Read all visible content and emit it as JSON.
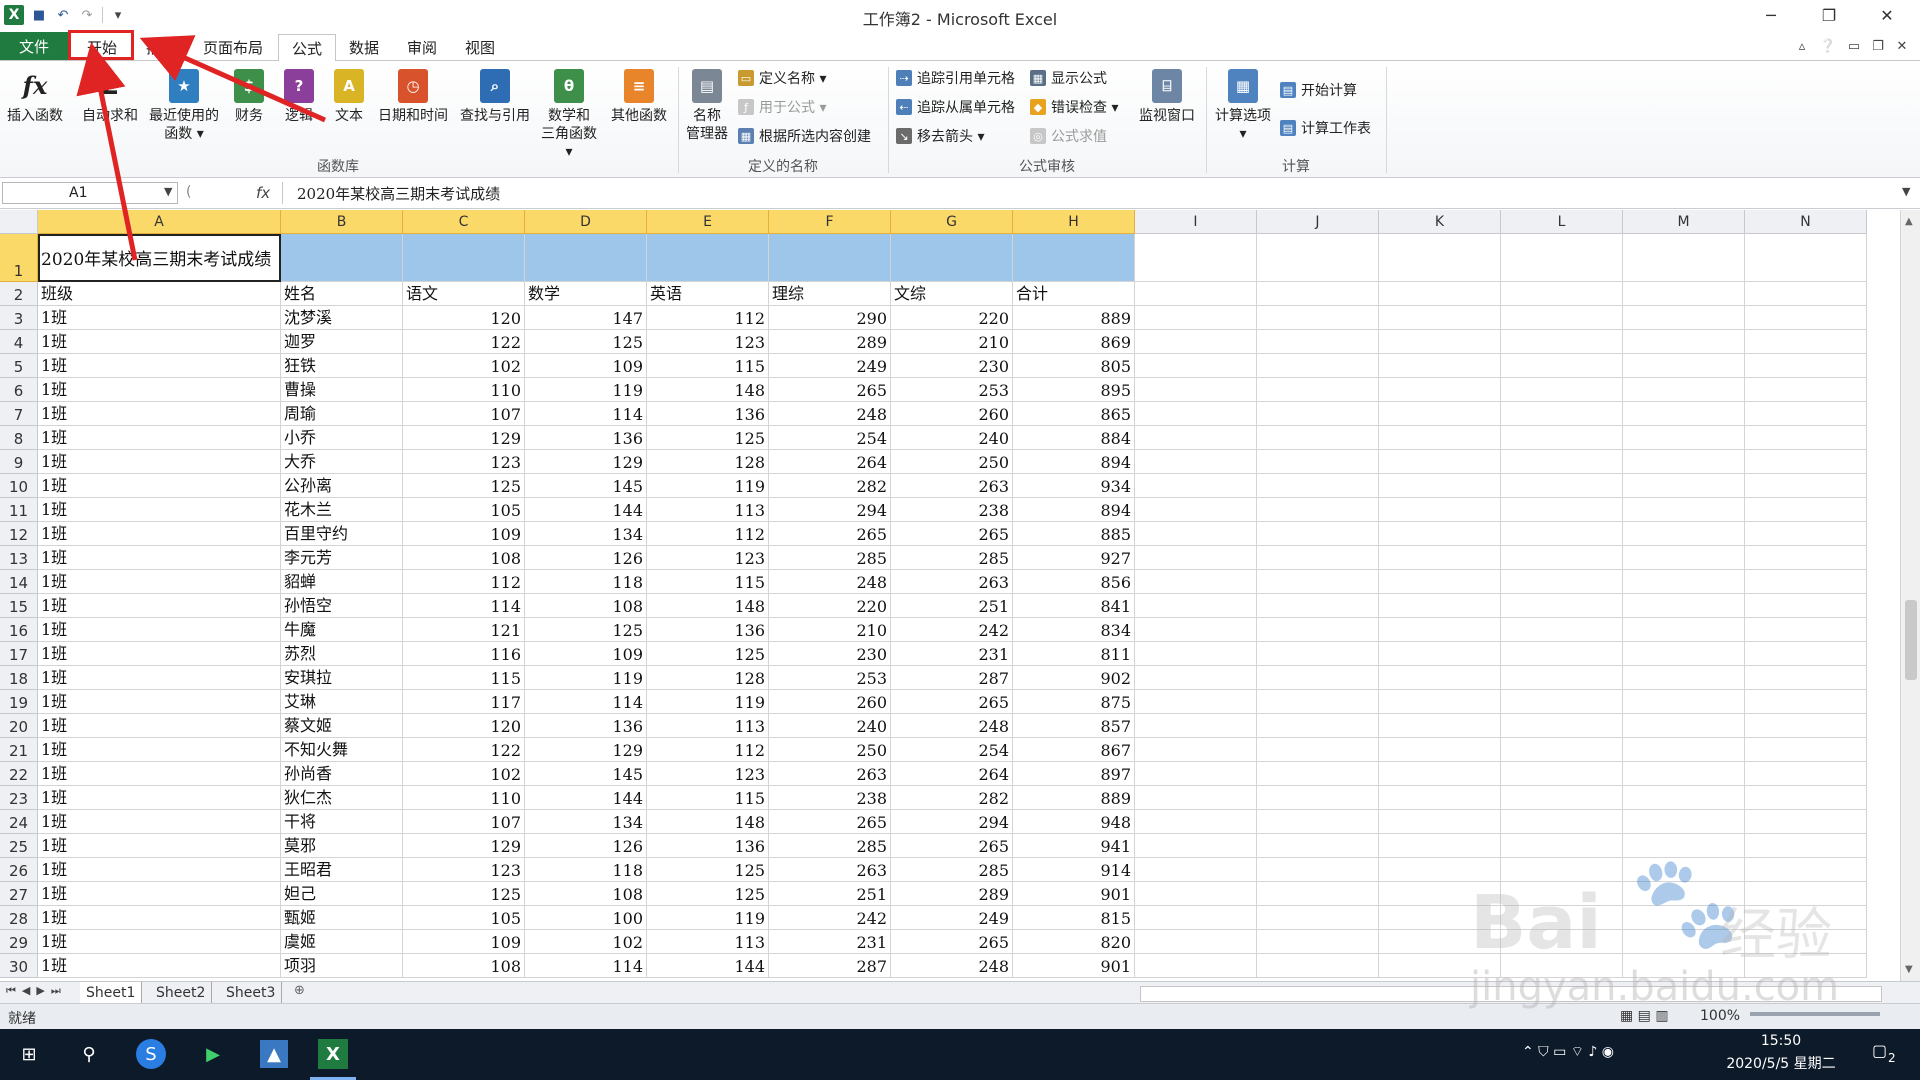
{
  "window": {
    "title": "工作簿2 - Microsoft Excel",
    "minimize": "─",
    "restore": "❐",
    "close": "✕"
  },
  "qat": {
    "logo": "X",
    "save": "💾",
    "undo": "↶",
    "redo": "↷",
    "more": "▾"
  },
  "tabs": [
    {
      "label": "文件"
    },
    {
      "label": "开始"
    },
    {
      "label": "插入"
    },
    {
      "label": "页面布局"
    },
    {
      "label": "公式"
    },
    {
      "label": "数据"
    },
    {
      "label": "审阅"
    },
    {
      "label": "视图"
    }
  ],
  "ribbon": {
    "groups": {
      "function_library": "函数库",
      "defined_names": "定义的名称",
      "formula_auditing": "公式审核",
      "calculation": "计算"
    },
    "insert_function": "插入函数",
    "autosum": "自动求和",
    "recent_1": "最近使用的",
    "recent_2": "函数 ▾",
    "financial": "财务",
    "logical": "逻辑",
    "text": "文本",
    "datetime": "日期和时间",
    "lookup": "查找与引用",
    "math_1": "数学和",
    "math_2": "三角函数 ▾",
    "other": "其他函数",
    "name_mgr_1": "名称",
    "name_mgr_2": "管理器",
    "define_name": "定义名称 ▾",
    "use_in_formula": "用于公式 ▾",
    "create_from_sel": "根据所选内容创建",
    "trace_precedents": "追踪引用单元格",
    "trace_dependents": "追踪从属单元格",
    "remove_arrows": "移去箭头 ▾",
    "show_formulas": "显示公式",
    "error_check": "错误检查 ▾",
    "eval_formula": "公式求值",
    "watch_window": "监视窗口",
    "calc_options": "计算选项",
    "calc_now": "开始计算",
    "calc_sheet": "计算工作表"
  },
  "formula_bar": {
    "name_box": "A1",
    "fx": "fx",
    "formula": "2020年某校高三期末考试成绩"
  },
  "columns": [
    "A",
    "B",
    "C",
    "D",
    "E",
    "F",
    "G",
    "H",
    "I",
    "J",
    "K",
    "L",
    "M",
    "N"
  ],
  "sheet": {
    "title": "2020年某校高三期末考试成绩",
    "headers": [
      "班级",
      "姓名",
      "语文",
      "数学",
      "英语",
      "理综",
      "文综",
      "合计"
    ],
    "rows": [
      [
        "1班",
        "沈梦溪",
        "120",
        "147",
        "112",
        "290",
        "220",
        "889"
      ],
      [
        "1班",
        "迦罗",
        "122",
        "125",
        "123",
        "289",
        "210",
        "869"
      ],
      [
        "1班",
        "狂铁",
        "102",
        "109",
        "115",
        "249",
        "230",
        "805"
      ],
      [
        "1班",
        "曹操",
        "110",
        "119",
        "148",
        "265",
        "253",
        "895"
      ],
      [
        "1班",
        "周瑜",
        "107",
        "114",
        "136",
        "248",
        "260",
        "865"
      ],
      [
        "1班",
        "小乔",
        "129",
        "136",
        "125",
        "254",
        "240",
        "884"
      ],
      [
        "1班",
        "大乔",
        "123",
        "129",
        "128",
        "264",
        "250",
        "894"
      ],
      [
        "1班",
        "公孙离",
        "125",
        "145",
        "119",
        "282",
        "263",
        "934"
      ],
      [
        "1班",
        "花木兰",
        "105",
        "144",
        "113",
        "294",
        "238",
        "894"
      ],
      [
        "1班",
        "百里守约",
        "109",
        "134",
        "112",
        "265",
        "265",
        "885"
      ],
      [
        "1班",
        "李元芳",
        "108",
        "126",
        "123",
        "285",
        "285",
        "927"
      ],
      [
        "1班",
        "貂蝉",
        "112",
        "118",
        "115",
        "248",
        "263",
        "856"
      ],
      [
        "1班",
        "孙悟空",
        "114",
        "108",
        "148",
        "220",
        "251",
        "841"
      ],
      [
        "1班",
        "牛魔",
        "121",
        "125",
        "136",
        "210",
        "242",
        "834"
      ],
      [
        "1班",
        "苏烈",
        "116",
        "109",
        "125",
        "230",
        "231",
        "811"
      ],
      [
        "1班",
        "安琪拉",
        "115",
        "119",
        "128",
        "253",
        "287",
        "902"
      ],
      [
        "1班",
        "艾琳",
        "117",
        "114",
        "119",
        "260",
        "265",
        "875"
      ],
      [
        "1班",
        "蔡文姬",
        "120",
        "136",
        "113",
        "240",
        "248",
        "857"
      ],
      [
        "1班",
        "不知火舞",
        "122",
        "129",
        "112",
        "250",
        "254",
        "867"
      ],
      [
        "1班",
        "孙尚香",
        "102",
        "145",
        "123",
        "263",
        "264",
        "897"
      ],
      [
        "1班",
        "狄仁杰",
        "110",
        "144",
        "115",
        "238",
        "282",
        "889"
      ],
      [
        "1班",
        "干将",
        "107",
        "134",
        "148",
        "265",
        "294",
        "948"
      ],
      [
        "1班",
        "莫邪",
        "129",
        "126",
        "136",
        "285",
        "265",
        "941"
      ],
      [
        "1班",
        "王昭君",
        "123",
        "118",
        "125",
        "263",
        "285",
        "914"
      ],
      [
        "1班",
        "妲己",
        "125",
        "108",
        "125",
        "251",
        "289",
        "901"
      ],
      [
        "1班",
        "甄姬",
        "105",
        "100",
        "119",
        "242",
        "249",
        "815"
      ],
      [
        "1班",
        "虞姬",
        "109",
        "102",
        "113",
        "231",
        "265",
        "820"
      ],
      [
        "1班",
        "项羽",
        "108",
        "114",
        "144",
        "287",
        "248",
        "901"
      ]
    ]
  },
  "sheet_tabs": [
    "Sheet1",
    "Sheet2",
    "Sheet3"
  ],
  "status": {
    "ready": "就绪",
    "zoom": "100%"
  },
  "taskbar": {
    "time": "15:50",
    "date": "2020/5/5 星期二",
    "notif": "2"
  },
  "watermark": {
    "brand": "Bai",
    "sub": "jingyan.baidu.com",
    "cn": "经验"
  },
  "colors": {
    "excel_green": "#1f7b3f",
    "selection_blue": "#9ec5ea",
    "header_selected": "#fbd969",
    "arrow_red": "#e02424"
  }
}
